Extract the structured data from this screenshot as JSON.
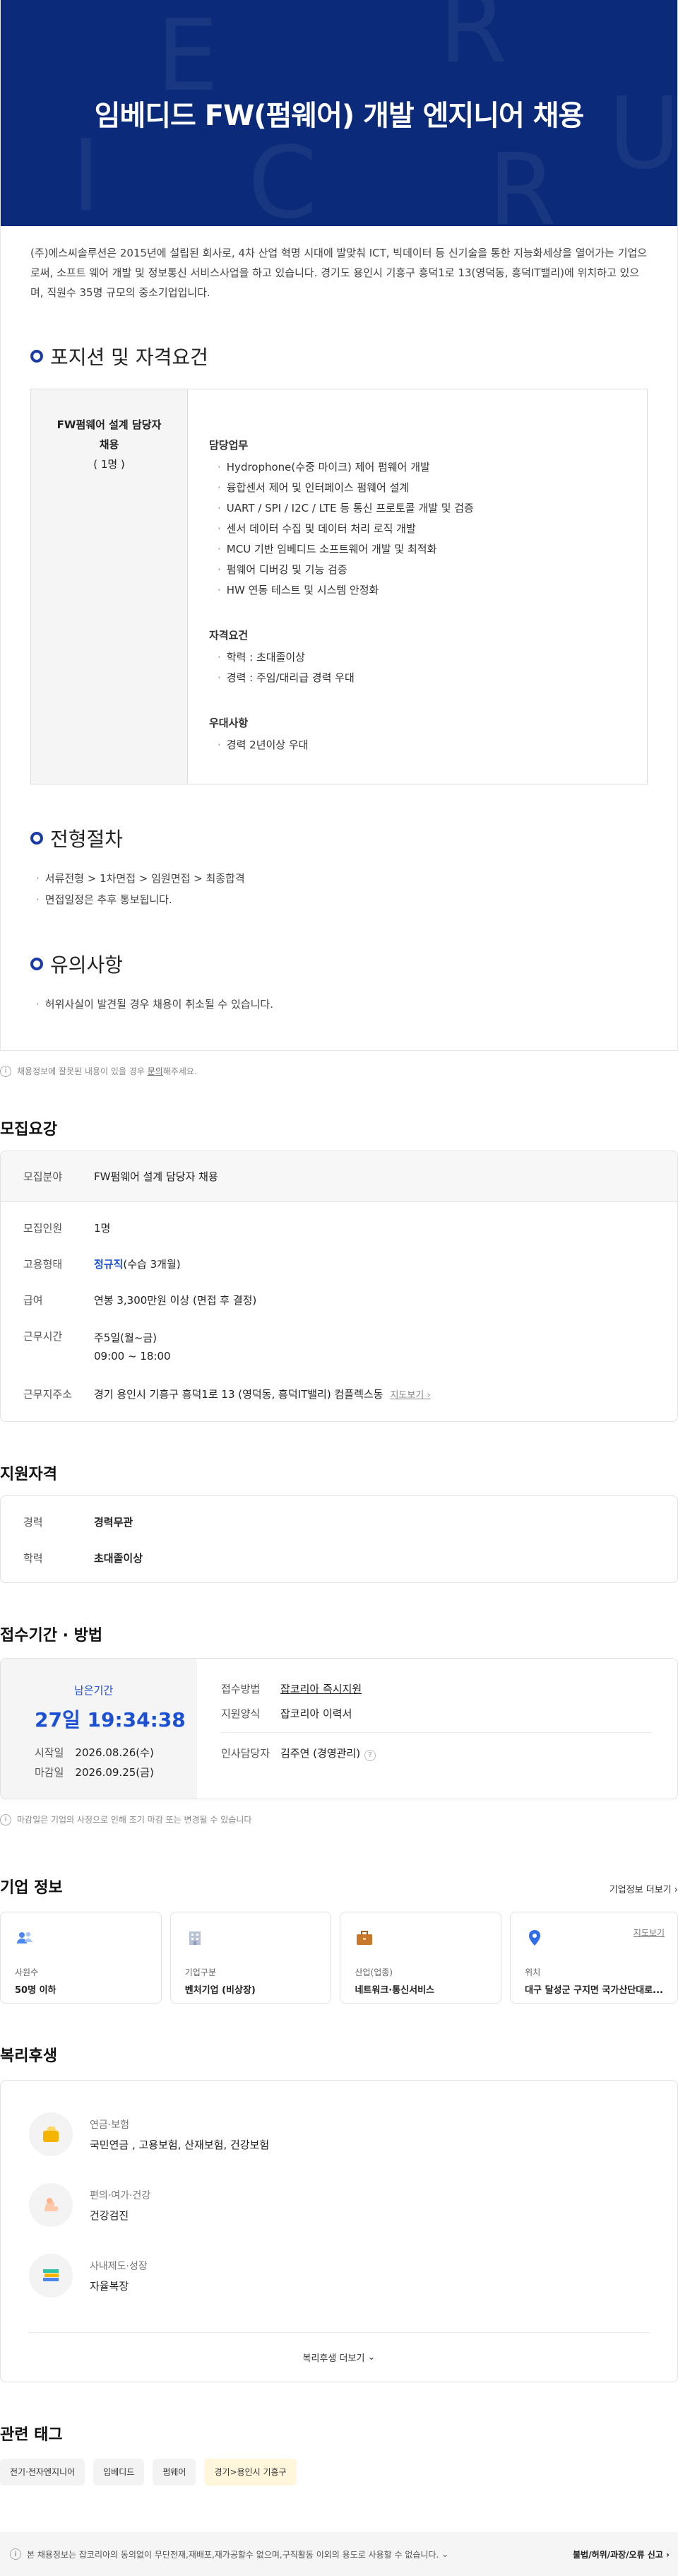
{
  "hero": {
    "title": "임베디드 FW(펌웨어) 개발 엔지니어 채용",
    "bg_letters": [
      "E",
      "R",
      "I",
      "C",
      "U",
      "R"
    ]
  },
  "intro": "(주)에스씨솔루션은 2015년에 설립된 회사로, 4차 산업 혁명 시대에 발맞춰 ICT, 빅데이터 등 신기술을 통한 지능화세상을 열어가는 기업으로써, 소프트 웨어 개발 및 정보통신 서비스사업을 하고 있습니다. 경기도 용인시 기흥구 흥덕1로 13(영덕동, 흥덕IT밸리)에 위치하고 있으며, 직원수 35명 규모의 중소기업입니다.",
  "sections": {
    "position": "포지션 및 자격요건",
    "process": "전형절차",
    "caution": "유의사항"
  },
  "position": {
    "name_line1": "FW펌웨어 설계 담당자",
    "name_line2": "채용",
    "count": "( 1명 )",
    "groups": [
      {
        "title": "담당업무",
        "items": [
          "Hydrophone(수중 마이크) 제어 펌웨어 개발",
          "융합센서 제어 및 인터페이스 펌웨어 설계",
          "UART / SPI / I2C / LTE 등 통신 프로토콜 개발 및 검증",
          "센서 데이터 수집 및 데이터 처리 로직 개발",
          "MCU 기반 임베디드 소프트웨어 개발 및 최적화",
          "펌웨어 디버깅 및 기능 검증",
          "HW 연동 테스트 및 시스템 안정화"
        ]
      },
      {
        "title": "자격요건",
        "items": [
          "학력 : 초대졸이상",
          "경력 : 주임/대리급 경력 우대"
        ]
      },
      {
        "title": "우대사항",
        "items": [
          "경력 2년이상 우대"
        ]
      }
    ]
  },
  "process_items": [
    "서류전형 > 1차면접 > 임원면접 > 최종합격",
    "면접일정은 추후 통보됩니다."
  ],
  "caution_items": [
    "허위사실이 발견될 경우 채용이 취소될 수 있습니다."
  ],
  "notice1": {
    "text": "채용정보에 잘못된 내용이 있을 경우",
    "link": "문의",
    "tail": "해주세요."
  },
  "summary": {
    "title": "모집요강",
    "head": {
      "k": "모집분야",
      "v": "FW펌웨어 설계 담당자 채용"
    },
    "headcount": {
      "k": "모집인원",
      "v": "1명"
    },
    "employment": {
      "k": "고용형태",
      "v_strong": "정규직",
      "v_rest": "(수습 3개월)"
    },
    "salary": {
      "k": "급여",
      "v": "연봉 3,300만원 이상 (면접 후 결정)"
    },
    "hours": {
      "k": "근무시간",
      "v1": "주5일(월~금)",
      "v2": "09:00 ~ 18:00"
    },
    "address": {
      "k": "근무지주소",
      "v": "경기 용인시 기흥구 흥덕1로 13 (영덕동, 흥덕IT밸리) 컴플렉스동",
      "map": "지도보기"
    }
  },
  "qualification": {
    "title": "지원자격",
    "career": {
      "k": "경력",
      "v": "경력무관"
    },
    "edu": {
      "k": "학력",
      "v": "초대졸이상"
    }
  },
  "period": {
    "title": "접수기간 · 방법",
    "remaining_label": "남은기간",
    "remaining": "27일 19:34:38",
    "start_k": "시작일",
    "start_v": "2026.08.26(수)",
    "end_k": "마감일",
    "end_v": "2026.09.25(금)",
    "method_k": "접수방법",
    "method_v": "잡코리아 즉시지원",
    "form_k": "지원양식",
    "form_v": "잡코리아 이력서",
    "manager_k": "인사담당자",
    "manager_v": "김주연 (경영관리)",
    "note": "마감일은 기업의 사정으로 인해 조기 마감 또는 변경될 수 있습니다"
  },
  "company": {
    "title": "기업 정보",
    "more": "기업정보 더보기",
    "cards": [
      {
        "label": "사원수",
        "value": "50명 이하",
        "icon": "people-icon"
      },
      {
        "label": "기업구분",
        "value": "벤처기업 (비상장)",
        "icon": "building-icon"
      },
      {
        "label": "산업(업종)",
        "value": "네트워크·통신서비스",
        "icon": "briefcase-icon"
      },
      {
        "label": "위치",
        "value": "대구 달성군 구지면 국가산단대로...",
        "icon": "location-pin-icon",
        "link": "지도보기"
      }
    ]
  },
  "welfare": {
    "title": "복리후생",
    "items": [
      {
        "cat": "연금·보험",
        "val": "국민연금 , 고용보험, 산재보험, 건강보험"
      },
      {
        "cat": "편의·여가·건강",
        "val": "건강검진"
      },
      {
        "cat": "사내제도·성장",
        "val": "자율복장"
      }
    ],
    "more": "복리후생 더보기"
  },
  "tags": {
    "title": "관련 태그",
    "items": [
      "전기·전자엔지니어",
      "임베디드",
      "펌웨어",
      "경기>용인시 기흥구"
    ]
  },
  "footer": {
    "left": "본 채용정보는 잡코리아의 동의없이 무단전재,재배포,재가공할수 없으며,구직활동 이외의 용도로 사용할 수 없습니다.",
    "right": "불법/허위/과장/오류 신고"
  },
  "colors": {
    "hero_bg": "#0b2a7a",
    "accent_blue": "#1b50d4"
  }
}
